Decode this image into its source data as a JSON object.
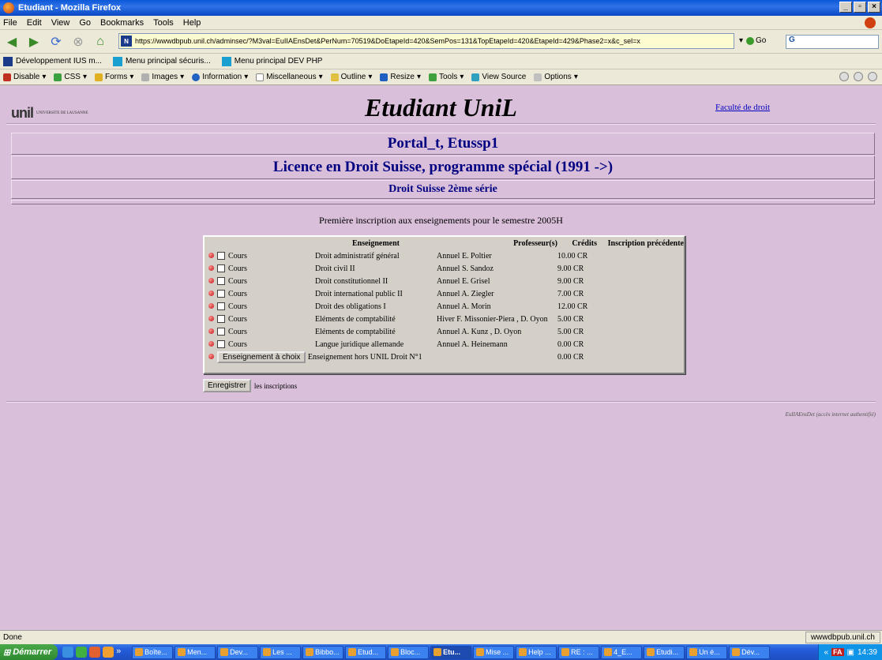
{
  "window": {
    "title": "Etudiant - Mozilla Firefox",
    "minimize": "_",
    "maximize": "▫",
    "close": "×"
  },
  "menu": [
    "File",
    "Edit",
    "View",
    "Go",
    "Bookmarks",
    "Tools",
    "Help"
  ],
  "nav": {
    "url": "https://wwwdbpub.unil.ch/adminsec/?M3val=EuIIAEnsDet&PerNum=70519&DoEtapeId=420&SemPos=131&TopEtapeId=420&EtapeId=429&Phase2=x&c_sel=x",
    "site_badge": "N",
    "go_label": "Go",
    "search_value": "G"
  },
  "bookmarks": [
    "Développement IUS m...",
    "Menu principal sécuris...",
    "Menu principal DEV PHP"
  ],
  "devtools": [
    "Disable",
    "CSS",
    "Forms",
    "Images",
    "Information",
    "Miscellaneous",
    "Outline",
    "Resize",
    "Tools",
    "View Source",
    "Options"
  ],
  "page": {
    "logo_text": "unil",
    "logo_small": "UNIVERSITE DE LAUSANNE",
    "title": "Etudiant UniL",
    "faculty_link": "Faculté de droit",
    "student_name": "Portal_t, Etussp1",
    "program": "Licence en Droit Suisse, programme spécial (1991 ->)",
    "series": "Droit Suisse 2ème série",
    "intro": "Première inscription aux enseignements pour le semestre 2005H"
  },
  "table": {
    "headers": {
      "course": "Enseignement",
      "prof": "Professeur(s)",
      "credits": "Crédits",
      "previous": "Inscription précédente"
    },
    "rows": [
      {
        "type": "Cours",
        "course": "Droit administratif général",
        "prof": "Annuel E. Poltier",
        "credits": "10.00 CR"
      },
      {
        "type": "Cours",
        "course": "Droit civil II",
        "prof": "Annuel S. Sandoz",
        "credits": "9.00 CR"
      },
      {
        "type": "Cours",
        "course": "Droit constitutionnel II",
        "prof": "Annuel E. Grisel",
        "credits": "9.00 CR"
      },
      {
        "type": "Cours",
        "course": "Droit international public II",
        "prof": "Annuel A. Ziegler",
        "credits": "7.00 CR"
      },
      {
        "type": "Cours",
        "course": "Droit des obligations I",
        "prof": "Annuel A. Morin",
        "credits": "12.00 CR"
      },
      {
        "type": "Cours",
        "course": "Eléments de comptabilité",
        "prof": "Hiver  F. Missonier-Piera , D. Oyon",
        "credits": "5.00 CR"
      },
      {
        "type": "Cours",
        "course": "Eléments de comptabilité",
        "prof": "Annuel A. Kunz , D. Oyon",
        "credits": "5.00 CR"
      },
      {
        "type": "Cours",
        "course": "Langue juridique allemande",
        "prof": "Annuel A. Heinemann",
        "credits": "0.00 CR"
      }
    ],
    "choice_button": "Enseignement à choix",
    "choice_course": "Enseignement hors UNIL Droit N°1",
    "choice_credits": "0.00 CR"
  },
  "save": {
    "button": "Enregistrer",
    "suffix": "les inscriptions"
  },
  "footer_note": "EuIIAEnsDet (accès internet authentifié)",
  "status": {
    "left": "Done",
    "right": "wwwdbpub.unil.ch"
  },
  "taskbar": {
    "start": "Démarrer",
    "more": "»",
    "tasks": [
      "Boîte...",
      "Men...",
      "Dev...",
      "Les ...",
      "Bibbo...",
      "Etud...",
      "Bloc...",
      "Etu...",
      "Mise ...",
      "Help ...",
      "RE : ...",
      "4_E...",
      "Etudi...",
      "Un é...",
      "Dév..."
    ],
    "active_index": 7,
    "tray_more": "«",
    "tray_badge": "FA",
    "clock": "14:39"
  }
}
